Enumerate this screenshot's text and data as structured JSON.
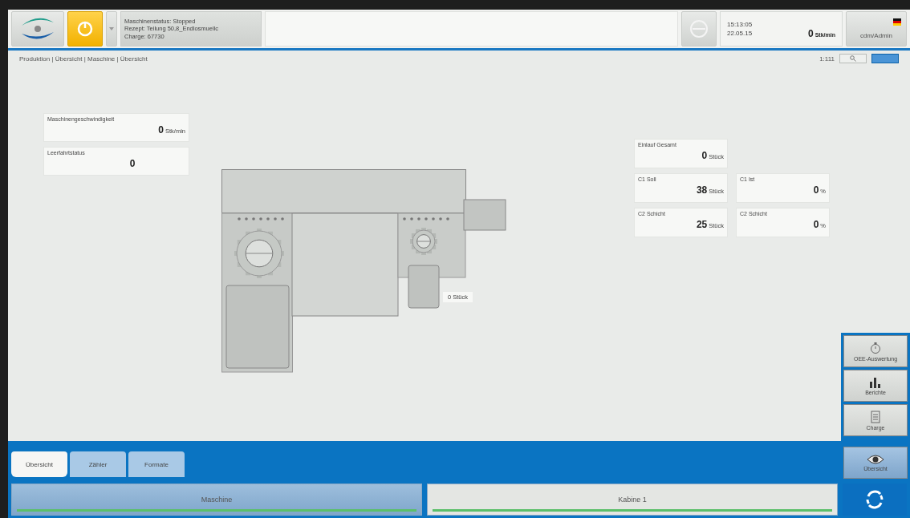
{
  "header": {
    "status_lines": [
      "Maschinenstatus: Stopped",
      "Rezept: Teilung 50,8_Endlosmuellc",
      "Charge: 67730"
    ],
    "time": "15:13:05",
    "date": "22.05.15",
    "rate": {
      "value": "0",
      "unit": "Stk/min"
    },
    "user": "cdm/Admin"
  },
  "breadcrumb": "Produktion | Übersicht | Maschine | Übersicht",
  "zoom_label": "1:111",
  "left_cards": [
    {
      "label": "Maschinengeschwindigkeit",
      "value": "0",
      "unit": "Stk/min"
    },
    {
      "label": "Leerfahrtstatus",
      "value": "0"
    }
  ],
  "right_cards": [
    [
      {
        "label": "Einlauf Gesamt",
        "value": "0",
        "unit": "Stück"
      }
    ],
    [
      {
        "label": "C1 Soll",
        "value": "38",
        "unit": "Stück"
      },
      {
        "label": "C1 Ist",
        "value": "0",
        "unit": "%"
      }
    ],
    [
      {
        "label": "C2 Schicht",
        "value": "25",
        "unit": "Stück"
      },
      {
        "label": "C2 Schicht",
        "value": "0",
        "unit": "%"
      }
    ]
  ],
  "machine": {
    "counter": "0 Stück"
  },
  "side_buttons": [
    {
      "label": "OEE-Auswertung",
      "kind": "timer",
      "selected": false
    },
    {
      "label": "Berichte",
      "kind": "chart",
      "selected": false
    },
    {
      "label": "Charge",
      "kind": "list",
      "selected": false
    },
    {
      "label": "Übersicht",
      "kind": "eye",
      "selected": true
    }
  ],
  "tabs": [
    {
      "label": "Übersicht",
      "selected": true
    },
    {
      "label": "Zähler",
      "selected": false
    },
    {
      "label": "Formate",
      "selected": false
    }
  ],
  "sections": [
    {
      "label": "Maschine",
      "selected": true
    },
    {
      "label": "Kabine 1",
      "selected": false
    }
  ]
}
